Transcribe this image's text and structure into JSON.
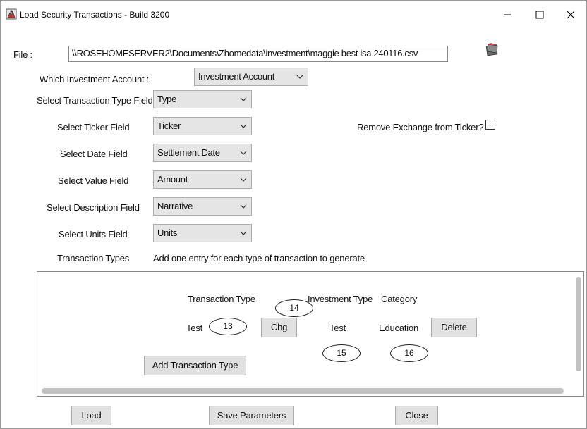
{
  "window": {
    "title": "Load Security Transactions - Build 3200"
  },
  "form": {
    "file_label": "File :",
    "file_path": "\\\\ROSEHOMESERVER2\\Documents\\Zhomedata\\investment\\maggie best isa 240116.csv",
    "investment_account_label": "Which Investment Account :",
    "investment_account_value": "Investment Account",
    "transaction_type_field_label": "Select Transaction Type Field",
    "transaction_type_field_value": "Type",
    "ticker_field_label": "Select Ticker Field",
    "ticker_field_value": "Ticker",
    "remove_exchange_label": "Remove Exchange from Ticker?",
    "date_field_label": "Select Date Field",
    "date_field_value": "Settlement Date",
    "value_field_label": "Select Value Field",
    "value_field_value": "Amount",
    "description_field_label": "Select Description Field",
    "description_field_value": "Narrative",
    "units_field_label": "Select Units Field",
    "units_field_value": "Units",
    "transaction_types_label": "Transaction Types",
    "transaction_types_hint": "Add one entry for each type of transaction to generate"
  },
  "panel": {
    "headers": {
      "transaction_type": "Transaction Type",
      "investment_type": "Investment Type",
      "category": "Category"
    },
    "row": {
      "transaction_type": "Test",
      "change_button": "Chg",
      "investment_type": "Test",
      "category": "Education",
      "delete_button": "Delete"
    },
    "add_button": "Add Transaction Type"
  },
  "annotations": {
    "a13": "13",
    "a14": "14",
    "a15": "15",
    "a16": "16"
  },
  "footer": {
    "load_button": "Load",
    "save_button": "Save Parameters",
    "close_button": "Close"
  },
  "icons": {
    "app": "app-icon",
    "minimize": "minimize-icon",
    "maximize": "maximize-icon",
    "close": "close-icon",
    "folder": "folder-icon",
    "dropdown": "chevron-down-icon"
  }
}
